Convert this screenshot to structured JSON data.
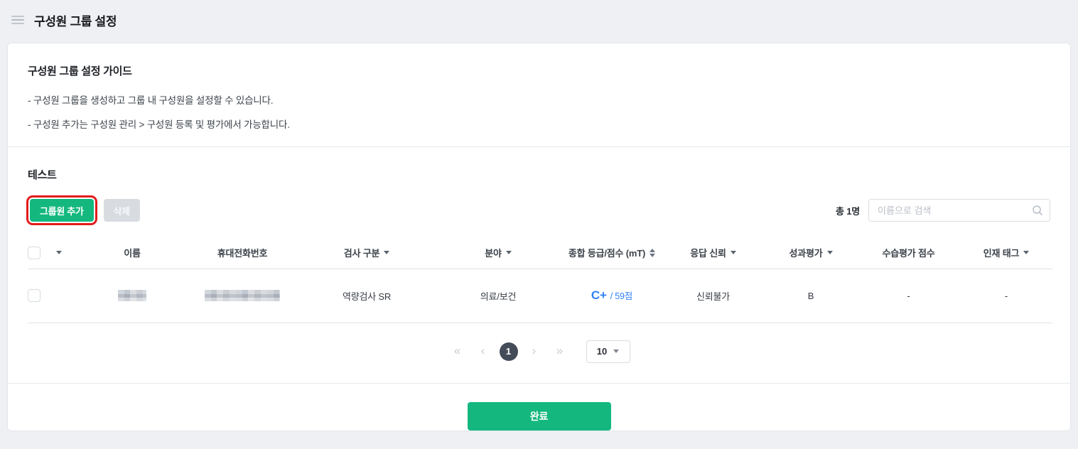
{
  "page": {
    "title": "구성원 그룹 설정"
  },
  "guide": {
    "title": "구성원 그룹 설정 가이드",
    "bullets": [
      "- 구성원 그룹을 생성하고 그룹 내 구성원을 설정할 수 있습니다.",
      "- 구성원 추가는 구성원 관리 > 구성원 등록 및 평가에서 가능합니다."
    ]
  },
  "group": {
    "name": "테스트",
    "add_member_label": "그룹원 추가",
    "delete_label": "삭제",
    "total_prefix": "총 ",
    "total_count": "1",
    "total_suffix": "명",
    "search_placeholder": "이름으로 검색"
  },
  "table": {
    "columns": [
      {
        "label": "이름",
        "icon": "none"
      },
      {
        "label": "휴대전화번호",
        "icon": "none"
      },
      {
        "label": "검사 구분",
        "icon": "caret"
      },
      {
        "label": "분야",
        "icon": "caret"
      },
      {
        "label": "종합 등급/점수 (mT)",
        "icon": "sort"
      },
      {
        "label": "응답 신뢰",
        "icon": "caret"
      },
      {
        "label": "성과평가",
        "icon": "caret"
      },
      {
        "label": "수습평가 점수",
        "icon": "none"
      },
      {
        "label": "인재 태그",
        "icon": "caret"
      }
    ],
    "rows": [
      {
        "name_redacted": true,
        "phone_redacted": true,
        "test_type": "역량검사 SR",
        "field": "의료/보건",
        "grade": "C+",
        "score": "/ 59점",
        "response_reliability": "신뢰불가",
        "performance": "B",
        "probation_score": "-",
        "talent_tag": "-"
      }
    ]
  },
  "pagination": {
    "first": "«",
    "prev": "‹",
    "current_page": "1",
    "next": "›",
    "last": "»",
    "page_size": "10"
  },
  "footer": {
    "complete_label": "완료"
  },
  "colors": {
    "accent_green": "#14b87f",
    "highlight_red": "#e31b1b",
    "score_blue": "#3182f6",
    "page_bg": "#eef0f3"
  }
}
